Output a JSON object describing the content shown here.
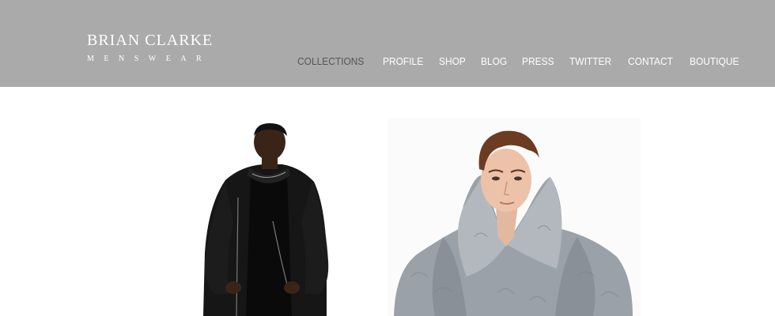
{
  "brand": {
    "name": "BRIAN CLARKE",
    "tagline": "MENSWEAR"
  },
  "nav": {
    "items": [
      {
        "label": "COLLECTIONS",
        "active": true
      },
      {
        "label": "PROFILE",
        "active": false
      },
      {
        "label": "SHOP",
        "active": false
      },
      {
        "label": "BLOG",
        "active": false
      },
      {
        "label": "PRESS",
        "active": false
      },
      {
        "label": "TWITTER",
        "active": false
      },
      {
        "label": "CONTACT",
        "active": false
      },
      {
        "label": "BOUTIQUE",
        "active": false
      }
    ]
  },
  "colors": {
    "header_bg": "#aaaaaa",
    "nav_text": "#ffffff",
    "nav_active": "#555555",
    "page_bg": "#ffffff"
  },
  "photos": [
    {
      "subject": "model in black knit coat"
    },
    {
      "subject": "model in grey fur coat"
    }
  ]
}
